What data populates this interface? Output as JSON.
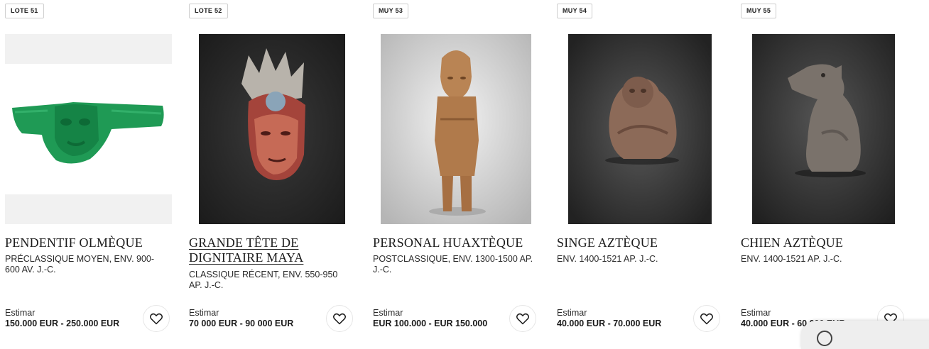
{
  "lots": [
    {
      "badge": "LOTE 51",
      "title": "PENDENTIF OLMÈQUE",
      "subtitle": "PRÉCLASSIQUE MOYEN, ENV. 900-600 AV. J.-C.",
      "estimate_label": "Estimar",
      "estimate_value": "150.000 EUR - 250.000 EUR",
      "image_icon": "jade-pendant-image",
      "favorite_icon": "heart-icon"
    },
    {
      "badge": "LOTE 52",
      "title": "GRANDE TÊTE DE DIGNITAIRE MAYA",
      "subtitle": "CLASSIQUE RÉCENT, ENV. 550-950 AP. J.-C.",
      "estimate_label": "Estimar",
      "estimate_value": "70 000 EUR - 90 000 EUR",
      "image_icon": "maya-head-image",
      "favorite_icon": "heart-icon"
    },
    {
      "badge": "MUY 53",
      "title": "PERSONAL HUAXTÈQUE",
      "subtitle": "POSTCLASSIQUE, ENV. 1300-1500 AP. J.-C.",
      "estimate_label": "Estimar",
      "estimate_value": "EUR 100.000 - EUR 150.000",
      "image_icon": "huaxtec-figure-image",
      "favorite_icon": "heart-icon"
    },
    {
      "badge": "MUY 54",
      "title": "SINGE AZTÈQUE",
      "subtitle": "ENV. 1400-1521 AP. J.-C.",
      "estimate_label": "Estimar",
      "estimate_value": "40.000 EUR - 70.000 EUR",
      "image_icon": "aztec-monkey-image",
      "favorite_icon": "heart-icon"
    },
    {
      "badge": "MUY 55",
      "title": "CHIEN AZTÈQUE",
      "subtitle": "ENV. 1400-1521 AP. J.-C.",
      "estimate_label": "Estimar",
      "estimate_value": "40.000 EUR - 60.000 EUR",
      "image_icon": "aztec-dog-image",
      "favorite_icon": "heart-icon"
    }
  ],
  "colors": {
    "text": "#1a1a1a",
    "badge_border": "#cfcfcf",
    "dark_photo_bg": "#2a2a2a",
    "jade": "#1f9a55"
  }
}
